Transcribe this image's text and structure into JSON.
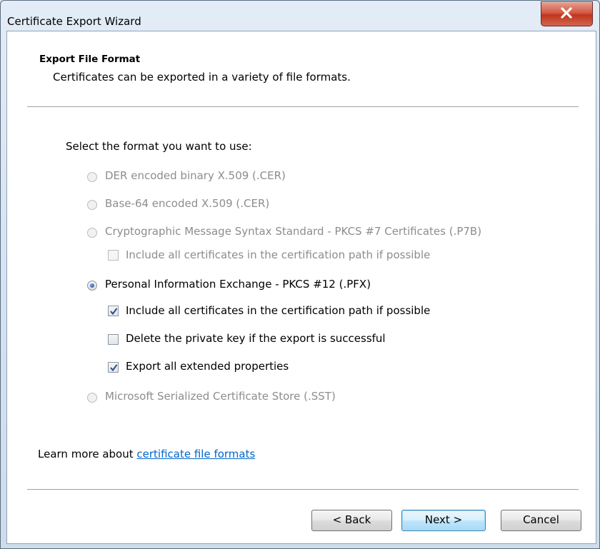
{
  "window": {
    "title": "Certificate Export Wizard",
    "close_icon": "close-icon"
  },
  "header": {
    "title": "Export File Format",
    "subtitle": "Certificates can be exported in a variety of file formats."
  },
  "prompt": "Select the format you want to use:",
  "options": {
    "der": {
      "label": "DER encoded binary X.509 (.CER)",
      "enabled": false,
      "selected": false
    },
    "base64": {
      "label": "Base-64 encoded X.509 (.CER)",
      "enabled": false,
      "selected": false
    },
    "pkcs7": {
      "label": "Cryptographic Message Syntax Standard - PKCS #7 Certificates (.P7B)",
      "enabled": false,
      "selected": false
    },
    "pkcs7_include": {
      "label": "Include all certificates in the certification path if possible",
      "enabled": false,
      "checked": false
    },
    "pfx": {
      "label": "Personal Information Exchange - PKCS #12 (.PFX)",
      "enabled": true,
      "selected": true
    },
    "pfx_include": {
      "label": "Include all certificates in the certification path if possible",
      "enabled": true,
      "checked": true
    },
    "pfx_delete_key": {
      "label": "Delete the private key if the export is successful",
      "enabled": true,
      "checked": false
    },
    "pfx_export_props": {
      "label": "Export all extended properties",
      "enabled": true,
      "checked": true
    },
    "sst": {
      "label": "Microsoft Serialized Certificate Store (.SST)",
      "enabled": false,
      "selected": false
    }
  },
  "learn_more": {
    "prefix": "Learn more about ",
    "link": "certificate file formats"
  },
  "buttons": {
    "back": "< Back",
    "next": "Next >",
    "cancel": "Cancel"
  }
}
